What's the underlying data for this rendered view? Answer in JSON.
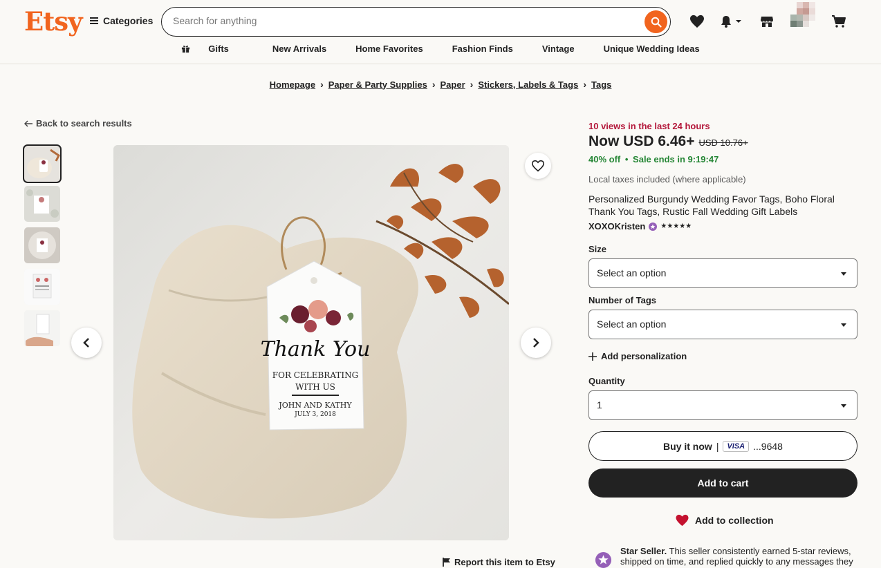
{
  "header": {
    "logo": "Etsy",
    "categories_label": "Categories",
    "search_placeholder": "Search for anything",
    "nav": [
      "Gifts",
      "New Arrivals",
      "Home Favorites",
      "Fashion Finds",
      "Vintage",
      "Unique Wedding Ideas"
    ]
  },
  "breadcrumbs": [
    "Homepage",
    "Paper & Party Supplies",
    "Paper",
    "Stickers, Labels & Tags",
    "Tags"
  ],
  "back_link": "Back to search results",
  "product_image": {
    "tag_line1": "Thank You",
    "tag_line2": "FOR CELEBRATING",
    "tag_line3": "WITH US",
    "tag_line4": "JOHN AND KATHY",
    "tag_line5": "JULY 3, 2018"
  },
  "report_link": "Report this item to Etsy",
  "listing": {
    "views": "10 views in the last 24 hours",
    "price_now": "Now USD 6.46+",
    "price_old": "USD 10.76+",
    "discount": "40% off",
    "sale_ends": "Sale ends in 9:19:47",
    "tax_note": "Local taxes included (where applicable)",
    "title": "Personalized Burgundy Wedding Favor Tags, Boho Floral Thank You Tags, Rustic Fall Wedding Gift Labels",
    "shop_name": "XOXOKristen",
    "stars": "★★★★★",
    "size_label": "Size",
    "size_value": "Select an option",
    "tags_label": "Number of Tags",
    "tags_value": "Select an option",
    "add_personalization": "Add personalization",
    "quantity_label": "Quantity",
    "quantity_value": "1",
    "buy_now": "Buy it now",
    "buy_sep": "|",
    "visa": "VISA",
    "card_digits": "...9648",
    "add_to_cart": "Add to cart",
    "add_to_collection": "Add to collection",
    "star_seller_bold": "Star Seller.",
    "star_seller_text": "This seller consistently earned 5-star reviews, shipped on time, and replied quickly to any messages they"
  },
  "colors": {
    "brand": "#f1641e",
    "views": "#b3173a",
    "sale": "#258635",
    "dark": "#222222"
  }
}
